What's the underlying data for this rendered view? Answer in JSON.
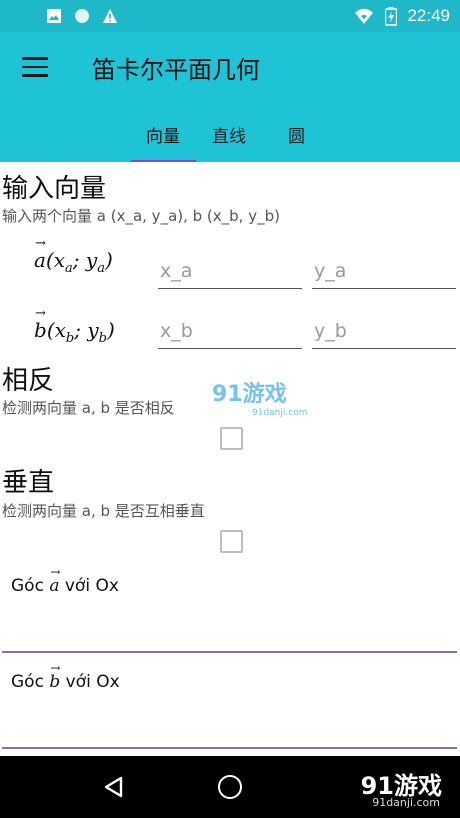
{
  "status_bar": {
    "time": "22:49"
  },
  "app": {
    "title": "笛卡尔平面几何"
  },
  "tabs": [
    {
      "label": "向量"
    },
    {
      "label": "直线"
    },
    {
      "label": "圆"
    }
  ],
  "input_section": {
    "title": "输入向量",
    "description": "输入两个向量 a (x_a, y_a), b (x_b, y_b)",
    "vector_a": {
      "placeholder_x": "x_a",
      "placeholder_y": "y_a"
    },
    "vector_b": {
      "placeholder_x": "x_b",
      "placeholder_y": "y_b"
    }
  },
  "opposite_section": {
    "title": "相反",
    "description": "检测两向量 a, b 是否相反"
  },
  "perpendicular_section": {
    "title": "垂直",
    "description": "检测两向量 a, b 是否互相垂直"
  },
  "angle_a": {
    "prefix": "Góc",
    "vector": "a",
    "suffix": "với Ox"
  },
  "angle_b": {
    "prefix": "Góc",
    "vector": "b",
    "suffix": "với Ox"
  },
  "watermark": {
    "text": "91游戏",
    "sub": "91danji.com"
  },
  "colors": {
    "accent": "#7d4ad6",
    "appbar": "#1fc3d6",
    "statusbar": "#1fb8c8"
  }
}
